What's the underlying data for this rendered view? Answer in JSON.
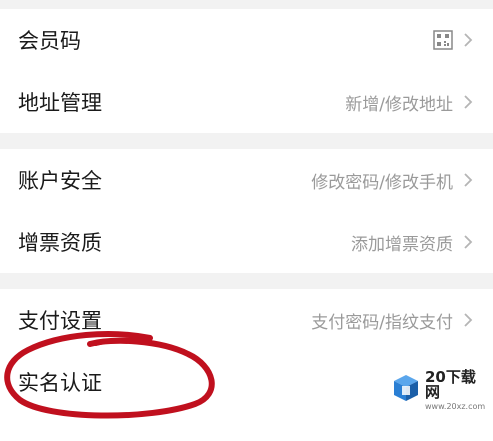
{
  "menu": {
    "group1": [
      {
        "label": "会员码",
        "detail": "",
        "icon": "qr-code-icon"
      },
      {
        "label": "地址管理",
        "detail": "新增/修改地址"
      }
    ],
    "group2": [
      {
        "label": "账户安全",
        "detail": "修改密码/修改手机"
      },
      {
        "label": "增票资质",
        "detail": "添加增票资质"
      }
    ],
    "group3": [
      {
        "label": "支付设置",
        "detail": "支付密码/指纹支付"
      },
      {
        "label": "实名认证",
        "detail": ""
      }
    ]
  },
  "watermark": {
    "title": "20下载网",
    "subtitle": "www.20xz.com"
  },
  "colors": {
    "annotation": "#c0101e",
    "chevron": "#b5b5b5",
    "watermark_blue": "#2a7fd4"
  }
}
